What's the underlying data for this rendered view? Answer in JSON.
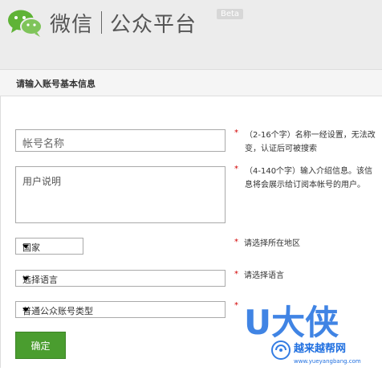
{
  "header": {
    "brand_left": "微信",
    "brand_right": "公众平台",
    "beta": "Beta"
  },
  "section": {
    "title": "请输入账号基本信息"
  },
  "form": {
    "account_name_placeholder": "帐号名称",
    "account_name_hint": "（2-16个字）名称一经设置，无法改变，认证后可被搜索",
    "description_placeholder": "用户说明",
    "description_hint": "（4-140个字）输入介绍信息。该信息将会展示给订阅本帐号的用户。",
    "country_value": "国家",
    "country_hint": "请选择所在地区",
    "language_value": "选择语言",
    "language_hint": "请选择语言",
    "account_type_value": "普通公众账号类型",
    "required_mark": "*",
    "confirm_label": "确定"
  },
  "watermark": {
    "text": "U大侠",
    "site": "越来越帮网",
    "url": "www.yueyangbang.com"
  },
  "colors": {
    "header_bg": "#ececec",
    "button_green": "#4a9d2f",
    "required_red": "#d20000",
    "watermark_blue": "#1f6fe0"
  }
}
